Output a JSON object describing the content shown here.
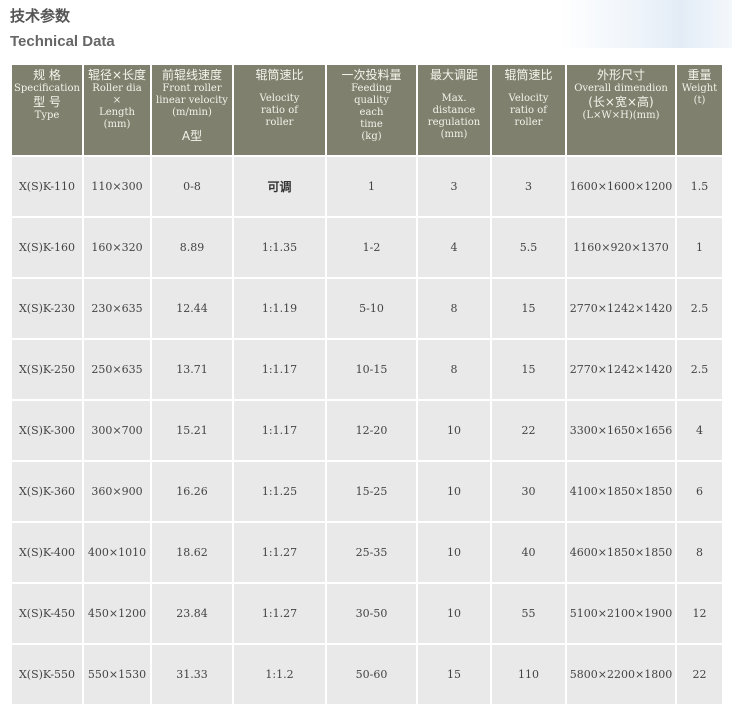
{
  "title_cn": "技术参数",
  "title_en": "Technical Data",
  "headers": [
    {
      "cn": "规 格",
      "en": "Specification",
      "cn2": "型 号",
      "en2": "Type"
    },
    {
      "cn": "辊径×长度",
      "en": "Roller dia",
      "en2": "×",
      "en3": "Length",
      "en4": "(mm)"
    },
    {
      "cn": "前辊线速度",
      "en": "Front roller",
      "en2": "linear velocity",
      "en3": "(m/min)",
      "cn2": "A型"
    },
    {
      "cn": "辊筒速比",
      "en": "Velocity",
      "en2": "ratio of",
      "en3": "roller"
    },
    {
      "cn": "一次投料量",
      "en": "Feeding",
      "en2": "quality",
      "en3": "each",
      "en4": "time",
      "en5": "(kg)"
    },
    {
      "cn": "最大调距",
      "en": "Max.",
      "en2": "distance",
      "en3": "regulation",
      "en4": "(mm)"
    },
    {
      "cn": "辊筒速比",
      "en": "Velocity",
      "en2": "ratio of",
      "en3": "roller"
    },
    {
      "cn": "外形尺寸",
      "en": "Overall dimendion",
      "cn2": "(长×宽×高)",
      "en2": "(L×W×H)(mm)"
    },
    {
      "cn": "重量",
      "en": "Weight",
      "en2": "(t)"
    }
  ],
  "rows": [
    [
      "X(S)K-110",
      "110×300",
      "0-8",
      "可调",
      "1",
      "3",
      "3",
      "1600×1600×1200",
      "1.5"
    ],
    [
      "X(S)K-160",
      "160×320",
      "8.89",
      "1:1.35",
      "1-2",
      "4",
      "5.5",
      "1160×920×1370",
      "1"
    ],
    [
      "X(S)K-230",
      "230×635",
      "12.44",
      "1:1.19",
      "5-10",
      "8",
      "15",
      "2770×1242×1420",
      "2.5"
    ],
    [
      "X(S)K-250",
      "250×635",
      "13.71",
      "1:1.17",
      "10-15",
      "8",
      "15",
      "2770×1242×1420",
      "2.5"
    ],
    [
      "X(S)K-300",
      "300×700",
      "15.21",
      "1:1.17",
      "12-20",
      "10",
      "22",
      "3300×1650×1656",
      "4"
    ],
    [
      "X(S)K-360",
      "360×900",
      "16.26",
      "1:1.25",
      "15-25",
      "10",
      "30",
      "4100×1850×1850",
      "6"
    ],
    [
      "X(S)K-400",
      "400×1010",
      "18.62",
      "1:1.27",
      "25-35",
      "10",
      "40",
      "4600×1850×1850",
      "8"
    ],
    [
      "X(S)K-450",
      "450×1200",
      "23.84",
      "1:1.27",
      "30-50",
      "10",
      "55",
      "5100×2100×1900",
      "12"
    ],
    [
      "X(S)K-550",
      "550×1530",
      "31.33",
      "1:1.2",
      "50-60",
      "15",
      "110",
      "5800×2200×1800",
      "22"
    ]
  ]
}
